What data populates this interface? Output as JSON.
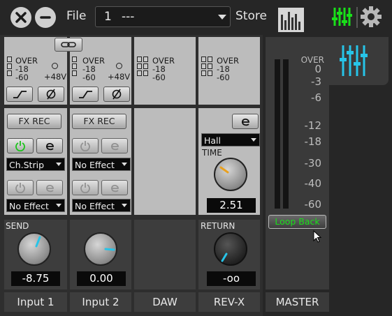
{
  "topbar": {
    "file_label": "File",
    "scene_number": "1",
    "scene_name": "---",
    "store_label": "Store"
  },
  "strips": [
    {
      "name": "Input 1",
      "over": "OVER",
      "m18": "-18",
      "m60": "-60",
      "phantom": "+48V",
      "fx_rec": "FX REC",
      "effect1": "Ch.Strip",
      "effect2": "No Effect",
      "send_label": "SEND",
      "send_value": "-8.75"
    },
    {
      "name": "Input 2",
      "over": "OVER",
      "m18": "-18",
      "m60": "-60",
      "phantom": "+48V",
      "fx_rec": "FX REC",
      "effect1": "No Effect",
      "effect2": "No Effect",
      "send_value": "0.00"
    },
    {
      "name": "DAW",
      "over": "OVER",
      "m18": "-18",
      "m60": "-60"
    },
    {
      "name": "REV-X",
      "over": "OVER",
      "m18": "-18",
      "m60": "-60",
      "reverb_type": "Hall",
      "time_label": "TIME",
      "time_value": "2.51",
      "return_label": "RETURN",
      "return_value": "-oo"
    }
  ],
  "master": {
    "name": "MASTER",
    "loopback_label": "Loop Back",
    "scale": [
      "OVER",
      "0",
      "-3",
      "-6",
      "-12",
      "-18",
      "-30",
      "-40",
      "-60"
    ]
  },
  "colors": {
    "accent_green": "#19e019",
    "accent_cyan": "#27c4e8",
    "panel": "#bcbcbc"
  }
}
